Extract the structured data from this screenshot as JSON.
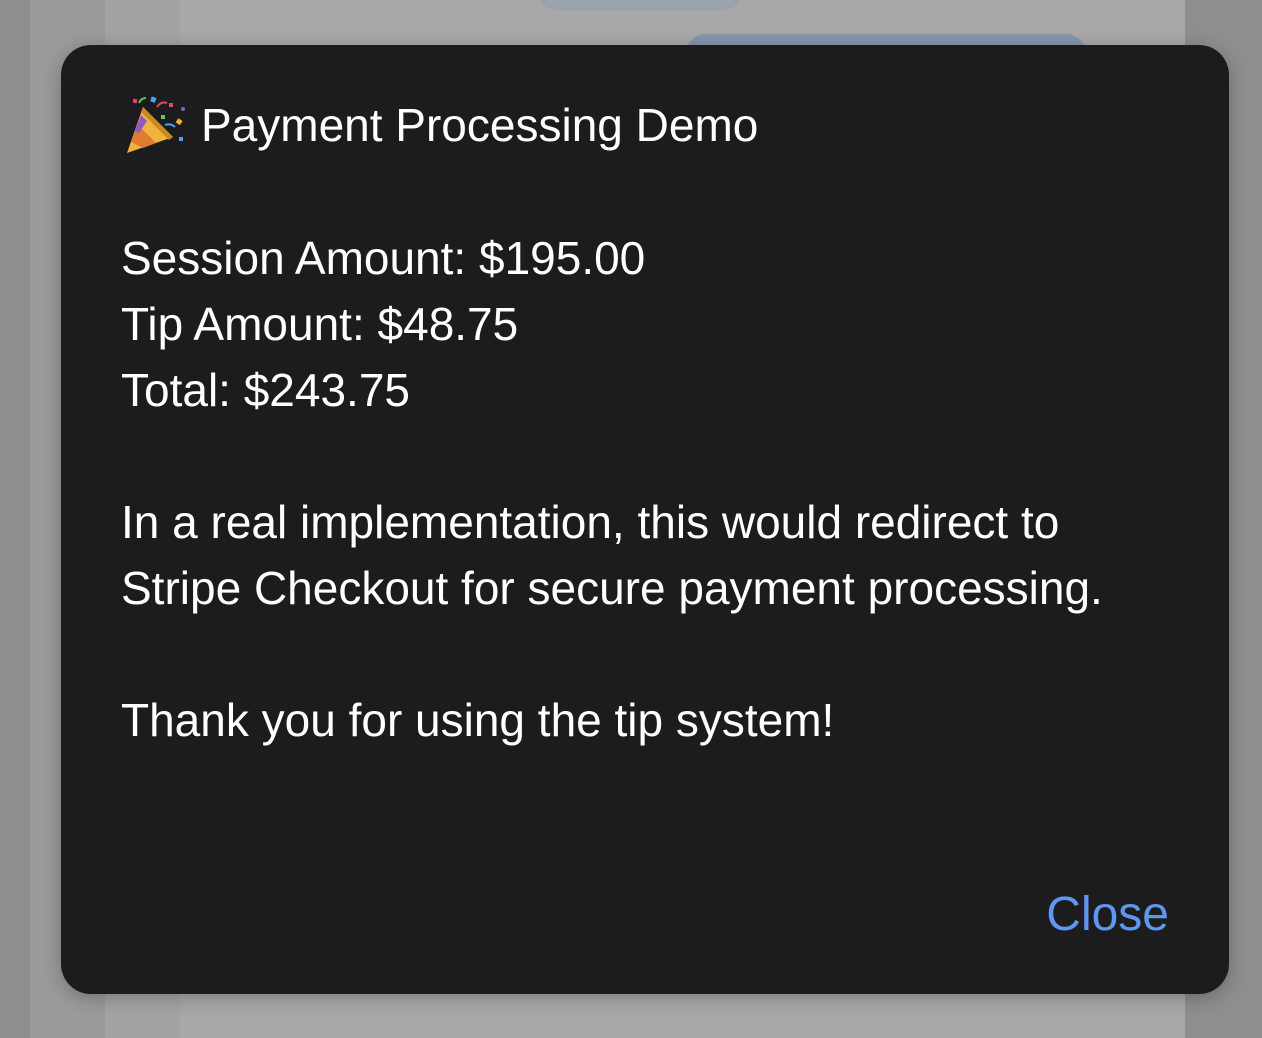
{
  "dialog": {
    "icon": "party-popper-icon",
    "title": "Payment Processing Demo",
    "lines": {
      "session": "Session Amount: $195.00",
      "tip": "Tip Amount: $48.75",
      "total": "Total: $243.75"
    },
    "message": "In a real implementation, this would redirect to Stripe Checkout for secure payment processing.",
    "thanks": "Thank you for using the tip system!",
    "close_label": "Close"
  },
  "colors": {
    "dialog_bg": "#1c1c1e",
    "text": "#ffffff",
    "accent": "#5e97f0",
    "backdrop": "#8e8e8e"
  }
}
